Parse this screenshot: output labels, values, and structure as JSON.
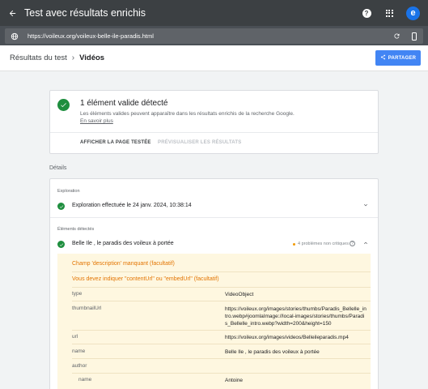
{
  "appbar": {
    "title": "Test avec résultats enrichis",
    "avatar_letter": "e"
  },
  "urlbar": {
    "url": "https://voileux.org/voileux-belle-ile-paradis.html"
  },
  "header": {
    "breadcrumb_root": "Résultats du test",
    "breadcrumb_current": "Vidéos",
    "share_label": "PARTAGER"
  },
  "result": {
    "title": "1 élément valide détecté",
    "description": "Les éléments valides peuvent apparaître dans les résultats enrichis de la recherche Google.",
    "learn_more": "En savoir plus",
    "view_tested_page": "AFFICHER LA PAGE TESTÉE",
    "preview_results": "PRÉVISUALISER LES RÉSULTATS"
  },
  "details": {
    "label": "Détails",
    "crawl_section": "Exploration",
    "crawl_text": "Exploration effectuée le 24 janv. 2024, 10:38:14",
    "detected_section": "Éléments détectés",
    "item_title": "Belle Ile , le paradis des voileux à portée",
    "issues_text": "4 problèmes non critiques",
    "warnings": [
      "Champ 'description' manquant (facultatif)",
      "Vous devez indiquer \"contentUrl\" ou \"embedUrl\" (facultatif)"
    ],
    "properties": [
      {
        "key": "type",
        "value": "VideoObject"
      },
      {
        "key": "thumbnailUrl",
        "value": "https://voileux.org/images/stories/thumbs/Paradis_Bellelle_intro.webp#joomlaImage://local-images/stories/thumbs/Paradis_Bellelle_intro.webp?width=200&height=150"
      },
      {
        "key": "url",
        "value": "https://voileux.org/images/videos/Belleileparadis.mp4"
      },
      {
        "key": "name",
        "value": "Belle Ile , le paradis des voileux à portée"
      },
      {
        "key": "author",
        "value": ""
      },
      {
        "key": "name",
        "value": "Antoine"
      }
    ]
  },
  "colors": {
    "appbar": "#3c4043",
    "accent": "#4285f4",
    "success": "#1e8e3e",
    "warning": "#e37400"
  }
}
